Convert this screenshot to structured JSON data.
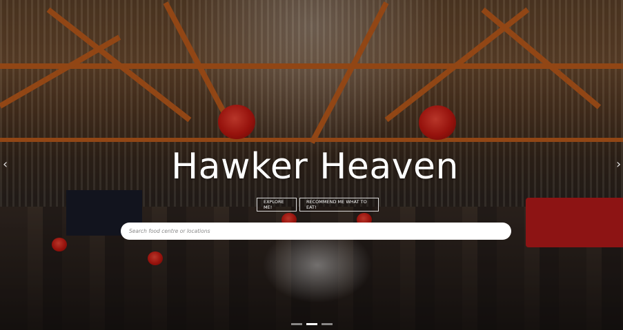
{
  "hero": {
    "title": "Hawker Heaven",
    "buttons": {
      "explore_label": "EXPLORE ME!",
      "recommend_label": "RECOMMEND ME WHAT TO EAT!"
    },
    "search": {
      "placeholder": "Search food centre or locations",
      "value": ""
    },
    "carousel": {
      "prev_icon": "chevron-left-icon",
      "next_icon": "chevron-right-icon",
      "prev_glyph": "‹",
      "next_glyph": "›",
      "slide_count": 3,
      "active_index": 1
    }
  },
  "colors": {
    "accent_red": "#d11a12",
    "truss_orange": "#c9611e",
    "text": "#ffffff"
  }
}
